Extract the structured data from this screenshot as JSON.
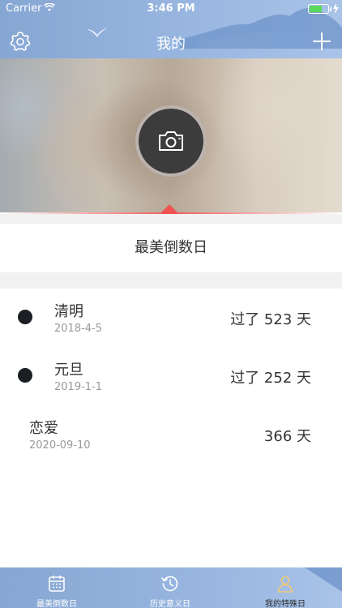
{
  "status_bar": {
    "carrier": "Carrier",
    "time": "3:46 PM",
    "battery_fill": 0.7,
    "battery_color": "#5ad95a"
  },
  "nav": {
    "title": "我的",
    "left_icon": "gear-icon",
    "right_icon": "plus-icon",
    "background": "#98b6e0"
  },
  "banner": {
    "camera_icon": "camera-icon",
    "accent": "#f0524f"
  },
  "section": {
    "title": "最美倒数日"
  },
  "events": [
    {
      "name": "清明",
      "date": "2018-4-5",
      "count": "过了 523 天",
      "dot": true
    },
    {
      "name": "元旦",
      "date": "2019-1-1",
      "count": "过了 252 天",
      "dot": true
    },
    {
      "name": "恋爱",
      "date": "2020-09-10",
      "count": "366 天",
      "dot": false
    }
  ],
  "tabs": [
    {
      "label": "最美倒数日",
      "icon": "calendar-icon",
      "active": false
    },
    {
      "label": "历史意义日",
      "icon": "history-icon",
      "active": false
    },
    {
      "label": "我的特殊日",
      "icon": "person-icon",
      "active": true
    }
  ]
}
